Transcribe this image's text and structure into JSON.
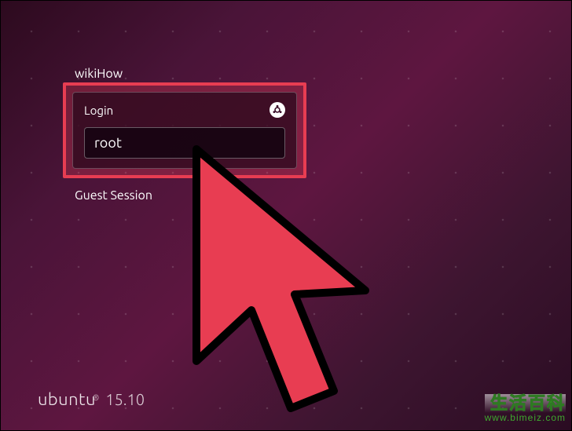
{
  "hostname": "wikiHow",
  "login": {
    "title": "Login",
    "username_value": "root",
    "username_placeholder": ""
  },
  "guest_session_label": "Guest Session",
  "branding": {
    "name": "ubuntu",
    "registered": "®",
    "version": "15.10"
  },
  "watermark": {
    "line1": "生活百科",
    "line2": "www.bimeiz.com"
  },
  "colors": {
    "highlight": "#e83d52",
    "cursor_fill": "#e83d52",
    "cursor_stroke": "#000000"
  }
}
